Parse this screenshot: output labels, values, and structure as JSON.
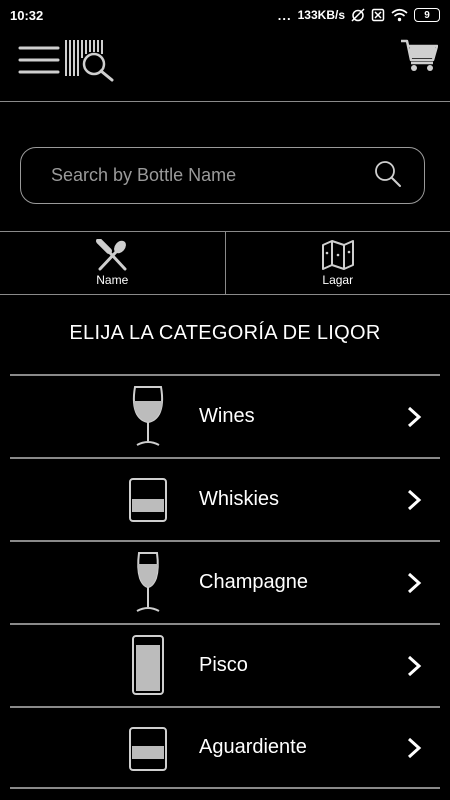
{
  "status_bar": {
    "time": "10:32",
    "dots": "...",
    "speed": "133KB/s",
    "battery": "9"
  },
  "search": {
    "placeholder": "Search by Bottle Name"
  },
  "filters": [
    {
      "label": "Name",
      "icon": "utensils-icon"
    },
    {
      "label": "Lagar",
      "icon": "map-icon"
    }
  ],
  "section_title": "ELIJA LA CATEGORÍA DE LIQOR",
  "categories": [
    {
      "label": "Wines",
      "icon": "wine-glass-icon"
    },
    {
      "label": "Whiskies",
      "icon": "whiskey-glass-icon"
    },
    {
      "label": "Champagne",
      "icon": "champagne-flute-icon"
    },
    {
      "label": "Pisco",
      "icon": "pisco-glass-icon"
    },
    {
      "label": "Aguardiente",
      "icon": "shot-glass-icon"
    }
  ]
}
